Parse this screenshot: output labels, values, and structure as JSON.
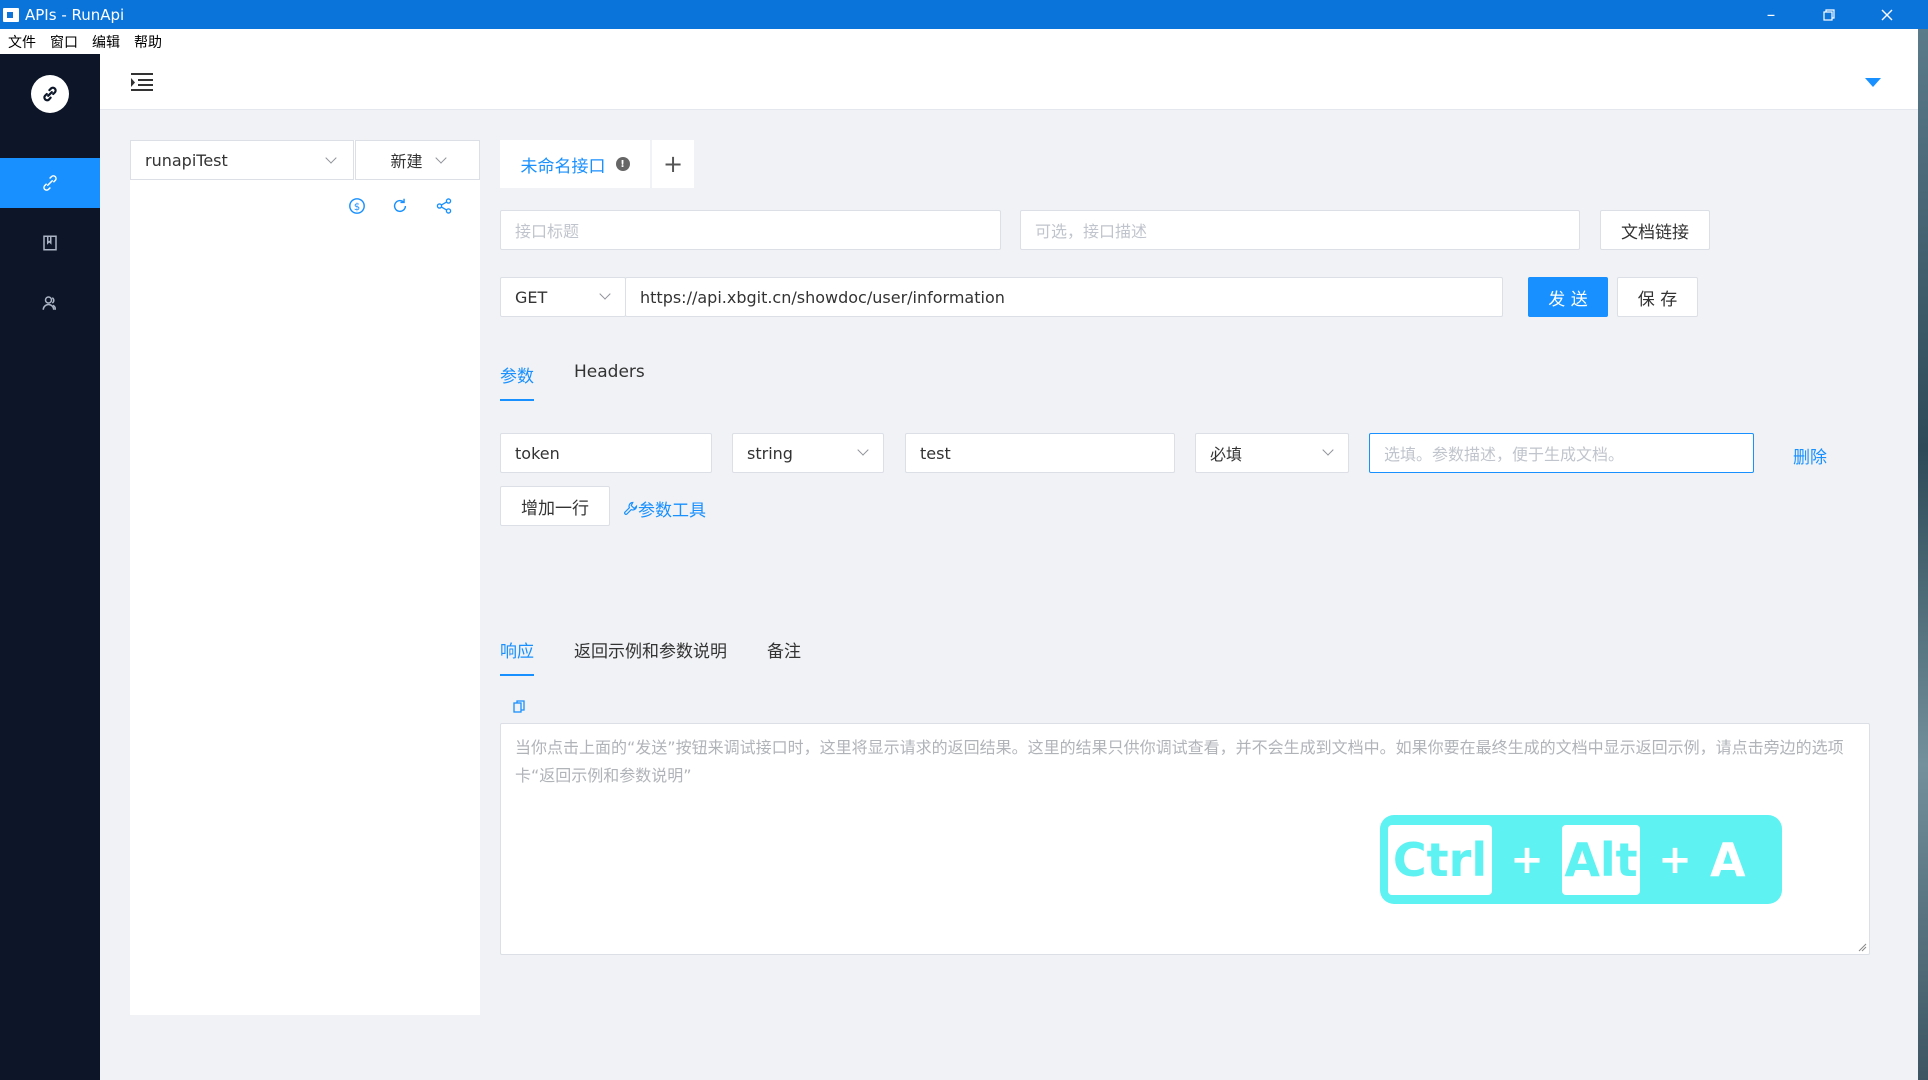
{
  "window": {
    "title": "APIs - RunApi"
  },
  "menu": [
    "文件",
    "窗口",
    "编辑",
    "帮助"
  ],
  "project": {
    "selected": "runapiTest",
    "new_label": "新建"
  },
  "tab": {
    "name": "未命名接口",
    "add": "+"
  },
  "api": {
    "title_placeholder": "接口标题",
    "desc_placeholder": "可选，接口描述",
    "doc_link_label": "文档链接",
    "method": "GET",
    "url": "https://api.xbgit.cn/showdoc/user/information",
    "send_label": "发 送",
    "save_label": "保 存"
  },
  "request_tabs": [
    "参数",
    "Headers"
  ],
  "param": {
    "name": "token",
    "type": "string",
    "value": "test",
    "required": "必填",
    "desc_placeholder": "选填。参数描述，便于生成文档。",
    "delete_label": "删除",
    "add_row_label": "增加一行",
    "tool_label": "参数工具"
  },
  "response_tabs": [
    "响应",
    "返回示例和参数说明",
    "备注"
  ],
  "response": {
    "placeholder": "当你点击上面的“发送”按钮来调试接口时，这里将显示请求的返回结果。这里的结果只供你调试查看，并不会生成到文档中。如果你要在最终生成的文档中显示返回示例，请点击旁边的选项卡“返回示例和参数说明”"
  },
  "shortcut_overlay": {
    "key1": "Ctrl",
    "plus1": "+",
    "key2": "Alt",
    "plus2": "+",
    "key3": "A"
  },
  "colors": {
    "accent": "#1890ff",
    "titlebar": "#0a74da",
    "rail": "#0c1628",
    "overlay": "#5ef2f2"
  }
}
